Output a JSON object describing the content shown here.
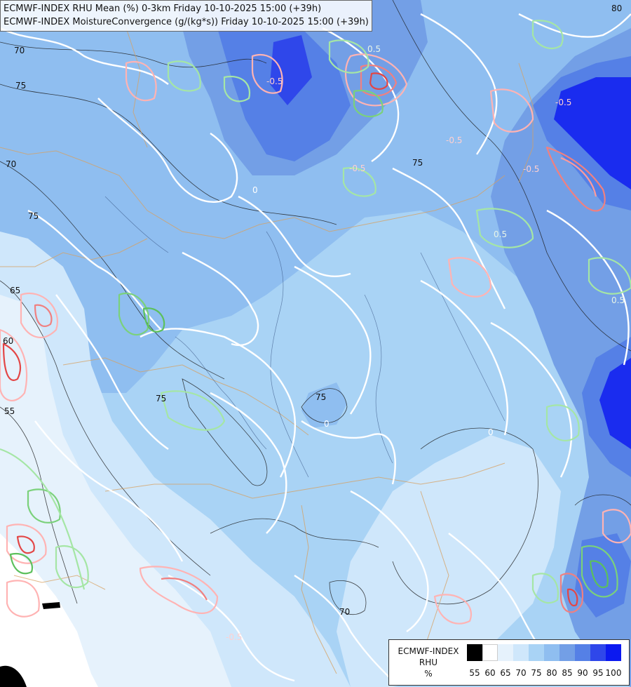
{
  "titles": {
    "line1": "ECMWF-INDEX RHU Mean (%) 0-3km Friday 10-10-2025 15:00 (+39h)",
    "line2": "ECMWF-INDEX MoistureConvergence (g/(kg*s)) Friday 10-10-2025 15:00 (+39h)"
  },
  "legend": {
    "title_lines": [
      "ECMWF-INDEX",
      "RHU",
      "%"
    ],
    "ticks": [
      "55",
      "60",
      "65",
      "70",
      "75",
      "80",
      "85",
      "90",
      "95",
      "100"
    ],
    "colors": [
      "#000000",
      "#ffffff",
      "#e6f2fc",
      "#cfe7fb",
      "#a9d3f5",
      "#8fbef0",
      "#739fe6",
      "#5580e6",
      "#2f47ea",
      "#0b19f0"
    ]
  },
  "rhu_contour_labels": [
    "80",
    "70",
    "75",
    "70",
    "75",
    "65",
    "60",
    "55",
    "75",
    "75",
    "75",
    "70"
  ],
  "convergence_labels": [
    "0.5",
    "-0.5",
    "0",
    "-0.5",
    "-0.5",
    "-0.5",
    "0",
    "0.5",
    "-0.5",
    "-0.5",
    "0",
    "0.5"
  ]
}
